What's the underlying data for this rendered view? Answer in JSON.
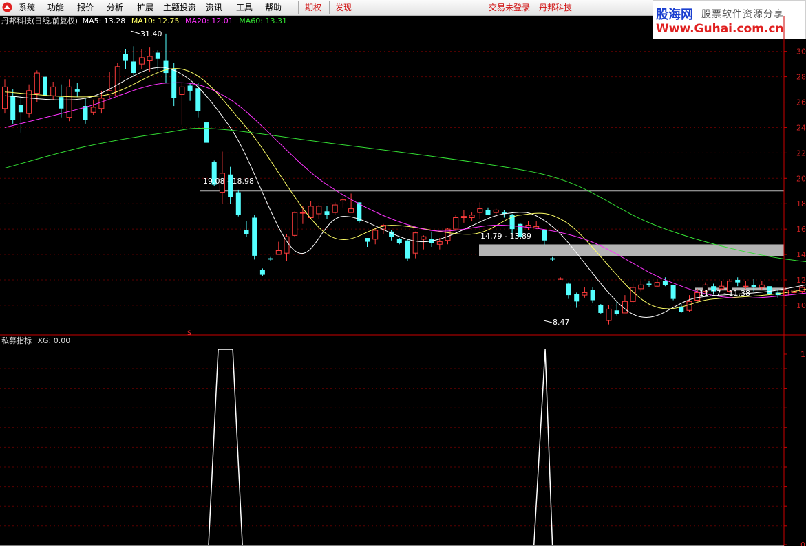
{
  "menu": {
    "system": "系统",
    "function": "功能",
    "quote": "报价",
    "analysis": "分析",
    "extend": "扩展",
    "theme": "主题投资",
    "info": "资讯",
    "tools": "工具",
    "help": "帮助",
    "futures": "期权",
    "discover": "发现",
    "login_status": "交易未登录",
    "current_stock": "丹邦科技"
  },
  "watermark": {
    "cn_name": "股海网",
    "slogan": "股票软件资源分享",
    "url": "Www.Guhai.com.cn"
  },
  "main_legend": {
    "title": "丹邦科技(日线,前复权)",
    "ma5_label": "MA5: 13.28",
    "ma10_label": "MA10: 12.75",
    "ma20_label": "MA20: 12.01",
    "ma60_label": "MA60: 13.31"
  },
  "indicator_legend": {
    "name": "私募指标",
    "xg_label": "XG: 0.00"
  },
  "annotations": {
    "high": "31.40",
    "low": "8.47",
    "zone1": "19.08 - 18.98",
    "zone2": "14.79 - 13.89",
    "zone3": "11.17 - 11.38",
    "signal_marker": "S"
  },
  "colors": {
    "up": "#ff3c3c",
    "down": "#54ffff",
    "ma5": "#ffffff",
    "ma10": "#ffff66",
    "ma20": "#ff33ff",
    "ma60": "#33dd33",
    "axis": "#cc0000"
  },
  "chart_data": {
    "type": "candlestick",
    "ylim": [
      8,
      31
    ],
    "y_ticks": [
      10,
      12,
      14,
      16,
      18,
      20,
      22,
      24,
      26,
      28,
      30
    ],
    "indicator_ticks": [
      1,
      0
    ],
    "zones": [
      {
        "label": "19.08 - 18.98",
        "value": 19.0,
        "style": "line"
      },
      {
        "label": "14.79 - 13.89",
        "from": 13.89,
        "to": 14.79,
        "style": "band"
      },
      {
        "label": "11.17 - 11.38",
        "from": 11.17,
        "to": 11.38,
        "style": "band"
      }
    ],
    "candles": [
      [
        25.5,
        27.2,
        25.1,
        27.8
      ],
      [
        26.5,
        24.6,
        24.3,
        27.0
      ],
      [
        25.8,
        25.2,
        23.6,
        26.5
      ],
      [
        25.1,
        26.9,
        24.8,
        27.4
      ],
      [
        26.7,
        28.3,
        26.0,
        28.5
      ],
      [
        28.0,
        26.5,
        25.4,
        28.3
      ],
      [
        26.5,
        27.2,
        26.2,
        27.6
      ],
      [
        26.4,
        25.5,
        24.8,
        27.4
      ],
      [
        24.8,
        27.2,
        24.5,
        27.8
      ],
      [
        27.0,
        26.8,
        26.4,
        27.5
      ],
      [
        25.7,
        24.6,
        24.3,
        26.3
      ],
      [
        25.2,
        25.6,
        25.0,
        26.2
      ],
      [
        25.5,
        26.3,
        25.1,
        26.9
      ],
      [
        26.5,
        26.9,
        26.3,
        28.4
      ],
      [
        26.5,
        28.8,
        26.4,
        29.1
      ],
      [
        29.8,
        29.3,
        28.6,
        30.2
      ],
      [
        29.2,
        28.3,
        28.0,
        30.4
      ],
      [
        29.0,
        29.5,
        28.6,
        30.2
      ],
      [
        29.3,
        29.6,
        28.4,
        30.3
      ],
      [
        29.9,
        29.4,
        28.5,
        30.1
      ],
      [
        29.3,
        28.3,
        27.5,
        31.4
      ],
      [
        28.6,
        26.3,
        25.7,
        29.1
      ],
      [
        26.6,
        27.2,
        24.2,
        27.5
      ],
      [
        27.3,
        26.9,
        26.1,
        27.5
      ],
      [
        27.1,
        25.3,
        24.8,
        27.5
      ],
      [
        24.4,
        22.8,
        22.7,
        24.5
      ],
      [
        21.3,
        19.5,
        19.4,
        21.4
      ],
      [
        18.9,
        20.4,
        18.0,
        22.1
      ],
      [
        20.3,
        18.5,
        18.0,
        20.9
      ],
      [
        18.9,
        17.1,
        17.0,
        19.1
      ],
      [
        15.9,
        15.6,
        15.4,
        16.6
      ],
      [
        16.9,
        13.9,
        13.6,
        17.1
      ],
      [
        12.8,
        12.4,
        12.3,
        12.9
      ],
      [
        13.7,
        13.6,
        13.5,
        13.8
      ],
      [
        14.0,
        14.3,
        14.2,
        15.0
      ],
      [
        14.1,
        15.4,
        13.5,
        15.6
      ],
      [
        15.5,
        17.3,
        15.4,
        17.4
      ],
      [
        17.3,
        17.3,
        16.4,
        17.8
      ],
      [
        16.9,
        17.8,
        16.8,
        18.2
      ],
      [
        17.2,
        17.8,
        16.8,
        17.9
      ],
      [
        17.4,
        17.1,
        16.8,
        17.8
      ],
      [
        17.3,
        17.9,
        17.1,
        18.1
      ],
      [
        18.2,
        18.3,
        17.7,
        18.6
      ],
      [
        17.3,
        17.6,
        17.5,
        18.8
      ],
      [
        18.1,
        16.6,
        16.5,
        18.1
      ],
      [
        15.3,
        15.0,
        14.6,
        15.3
      ],
      [
        15.2,
        15.9,
        14.8,
        16.1
      ],
      [
        16.0,
        16.3,
        15.6,
        16.4
      ],
      [
        15.8,
        15.4,
        15.1,
        15.9
      ],
      [
        15.2,
        14.9,
        14.8,
        15.3
      ],
      [
        15.1,
        13.7,
        13.5,
        15.2
      ],
      [
        14.1,
        15.7,
        13.7,
        15.8
      ],
      [
        15.2,
        15.4,
        14.4,
        15.5
      ],
      [
        15.2,
        14.9,
        14.6,
        15.8
      ],
      [
        14.8,
        15.0,
        14.4,
        15.3
      ],
      [
        15.1,
        16.0,
        14.8,
        16.1
      ],
      [
        16.0,
        16.9,
        15.9,
        17.1
      ],
      [
        16.9,
        17.0,
        16.5,
        17.5
      ],
      [
        16.9,
        17.1,
        16.6,
        17.3
      ],
      [
        17.3,
        17.6,
        16.8,
        18.1
      ],
      [
        17.5,
        17.1,
        17.1,
        17.7
      ],
      [
        17.3,
        17.5,
        17.0,
        17.6
      ],
      [
        17.3,
        17.2,
        16.9,
        17.5
      ],
      [
        17.1,
        16.0,
        15.5,
        17.2
      ],
      [
        16.4,
        15.4,
        15.2,
        16.5
      ],
      [
        16.1,
        16.3,
        15.9,
        16.6
      ],
      [
        16.1,
        16.2,
        16.0,
        16.6
      ],
      [
        15.9,
        15.1,
        14.7,
        16.0
      ],
      [
        13.7,
        13.6,
        13.5,
        13.8
      ],
      [
        12.1,
        12.1,
        12.0,
        12.2
      ],
      [
        11.7,
        10.8,
        10.5,
        11.8
      ],
      [
        10.9,
        10.3,
        9.8,
        11.0
      ],
      [
        10.8,
        11.0,
        10.6,
        11.4
      ],
      [
        11.2,
        10.4,
        10.2,
        11.4
      ],
      [
        10.0,
        9.4,
        9.3,
        10.1
      ],
      [
        8.8,
        9.7,
        8.5,
        10.0
      ],
      [
        9.6,
        9.3,
        9.2,
        10.3
      ],
      [
        9.4,
        10.3,
        9.4,
        10.8
      ],
      [
        10.3,
        11.4,
        10.2,
        11.7
      ],
      [
        11.3,
        11.6,
        11.1,
        11.9
      ],
      [
        11.7,
        11.6,
        11.4,
        11.9
      ],
      [
        11.5,
        11.8,
        11.4,
        12.1
      ],
      [
        11.9,
        11.6,
        11.5,
        12.2
      ],
      [
        11.6,
        10.5,
        10.4,
        11.6
      ],
      [
        9.9,
        9.5,
        9.4,
        10.1
      ],
      [
        9.6,
        10.3,
        9.5,
        10.8
      ],
      [
        10.4,
        11.0,
        10.3,
        11.3
      ],
      [
        11.1,
        11.6,
        10.9,
        11.8
      ],
      [
        11.5,
        11.1,
        10.9,
        11.7
      ],
      [
        11.3,
        11.5,
        11.2,
        11.9
      ],
      [
        11.1,
        11.9,
        11.0,
        12.1
      ],
      [
        12.0,
        11.8,
        11.5,
        12.2
      ],
      [
        11.5,
        11.5,
        11.3,
        11.9
      ],
      [
        11.6,
        11.4,
        11.1,
        12.1
      ],
      [
        11.4,
        11.6,
        11.2,
        11.9
      ],
      [
        11.5,
        10.9,
        10.7,
        11.7
      ],
      [
        11.0,
        10.8,
        10.6,
        11.3
      ],
      [
        10.8,
        11.2,
        10.7,
        11.4
      ],
      [
        11.0,
        11.2,
        10.8,
        11.4
      ],
      [
        11.1,
        11.4,
        10.9,
        11.5
      ],
      [
        11.4,
        11.7,
        11.2,
        11.9
      ],
      [
        11.7,
        11.9,
        11.6,
        12.0
      ],
      [
        11.9,
        12.5,
        11.8,
        12.7
      ],
      [
        12.5,
        12.7,
        12.3,
        12.9
      ],
      [
        12.4,
        12.3,
        12.1,
        12.5
      ],
      [
        12.2,
        13.4,
        12.1,
        13.6
      ],
      [
        13.4,
        13.4,
        13.2,
        13.8
      ],
      [
        13.3,
        13.5,
        13.1,
        13.7
      ],
      [
        13.6,
        13.5,
        13.2,
        13.8
      ],
      [
        13.7,
        12.5,
        12.3,
        13.8
      ]
    ],
    "ma_lines": {
      "ma5": [
        [
          0,
          26.5
        ],
        [
          10,
          26.3
        ],
        [
          20,
          28.7
        ],
        [
          28,
          24.0
        ],
        [
          36,
          14.3
        ],
        [
          42,
          17.0
        ],
        [
          52,
          15.0
        ],
        [
          62,
          17.2
        ],
        [
          68,
          16.2
        ],
        [
          78,
          9.3
        ],
        [
          86,
          10.6
        ],
        [
          96,
          11.2
        ],
        [
          110,
          13.0
        ]
      ],
      "ma10": [
        [
          0,
          26.8
        ],
        [
          12,
          26.5
        ],
        [
          22,
          28.6
        ],
        [
          30,
          24.0
        ],
        [
          40,
          15.6
        ],
        [
          48,
          16.3
        ],
        [
          58,
          15.6
        ],
        [
          64,
          17.1
        ],
        [
          70,
          16.4
        ],
        [
          80,
          10.1
        ],
        [
          88,
          10.5
        ],
        [
          98,
          11.1
        ],
        [
          110,
          12.9
        ]
      ],
      "ma20": [
        [
          0,
          24.0
        ],
        [
          10,
          25.6
        ],
        [
          20,
          27.5
        ],
        [
          28,
          26.2
        ],
        [
          40,
          19.5
        ],
        [
          52,
          16.0
        ],
        [
          62,
          16.3
        ],
        [
          72,
          15.2
        ],
        [
          82,
          12.0
        ],
        [
          90,
          10.6
        ],
        [
          100,
          11.0
        ],
        [
          110,
          12.0
        ]
      ],
      "ma60": [
        [
          0,
          20.8
        ],
        [
          10,
          22.5
        ],
        [
          20,
          23.6
        ],
        [
          26,
          23.9
        ],
        [
          40,
          22.8
        ],
        [
          60,
          21.1
        ],
        [
          70,
          19.7
        ],
        [
          80,
          16.5
        ],
        [
          90,
          14.5
        ],
        [
          100,
          13.4
        ],
        [
          110,
          13.3
        ]
      ]
    },
    "xg_signals": [
      {
        "rise_start": 25.3,
        "top_start": 26.5,
        "top_end": 28.3,
        "fall_end": 29.5
      },
      {
        "rise_start": 65.7,
        "peak": 67.1,
        "fall_end": 68.0
      }
    ]
  }
}
